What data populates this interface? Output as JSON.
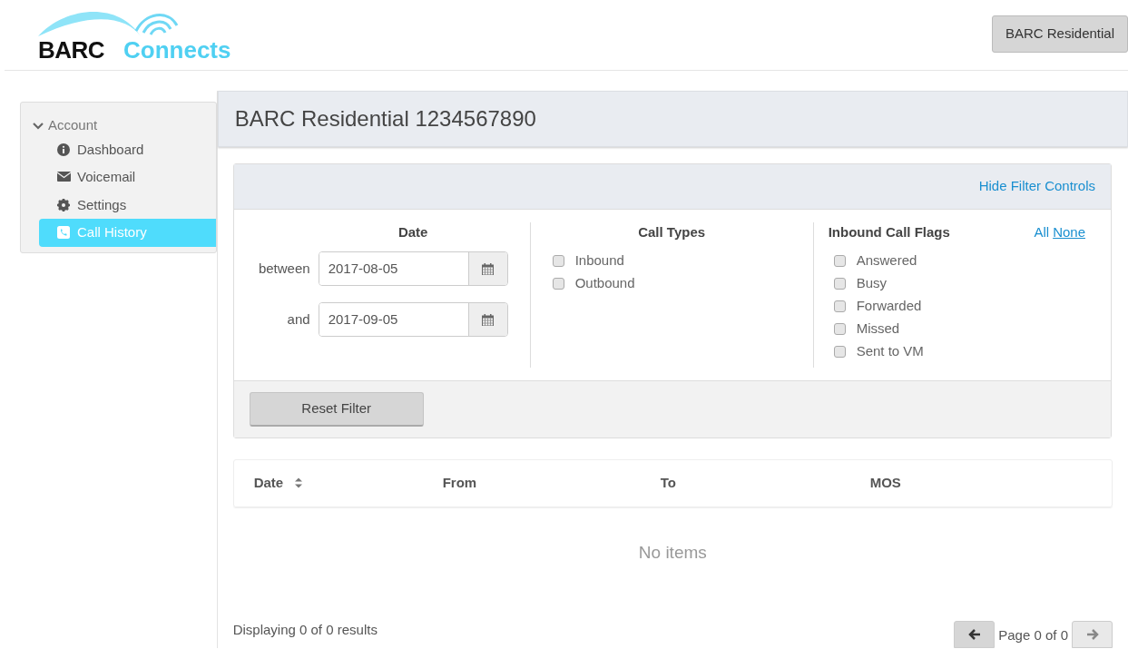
{
  "header": {
    "logo": {
      "word_1": "BARC",
      "word_2": "Connects"
    },
    "account_button": "BARC Residential"
  },
  "sidebar": {
    "group": {
      "label": "Account",
      "expanded": true,
      "items": [
        {
          "label": "Dashboard",
          "selected": false
        },
        {
          "label": "Voicemail",
          "selected": false
        },
        {
          "label": "Settings",
          "selected": false
        },
        {
          "label": "Call History",
          "selected": true
        }
      ]
    }
  },
  "page_title": "BARC Residential 1234567890",
  "filter": {
    "toggle_link": "Hide Filter Controls",
    "date": {
      "heading": "Date",
      "from_label": "between",
      "from_value": "2017-08-05",
      "to_label": "and",
      "to_value": "2017-09-05"
    },
    "call_types": {
      "heading": "Call Types",
      "options": [
        {
          "label": "Inbound",
          "checked": false
        },
        {
          "label": "Outbound",
          "checked": false
        }
      ]
    },
    "flags": {
      "heading": "Inbound Call Flags",
      "all_link": "All",
      "none_link": "None",
      "options": [
        {
          "label": "Answered",
          "checked": false
        },
        {
          "label": "Busy",
          "checked": false
        },
        {
          "label": "Forwarded",
          "checked": false
        },
        {
          "label": "Missed",
          "checked": false
        },
        {
          "label": "Sent to VM",
          "checked": false
        }
      ]
    },
    "reset_button": "Reset Filter"
  },
  "table": {
    "columns": [
      "Date",
      "From",
      "To",
      "MOS"
    ],
    "empty_text": "No items"
  },
  "footer": {
    "summary": "Displaying 0 of 0 results",
    "page_label": "Page 0 of 0",
    "prev_disabled": false,
    "next_disabled": true
  }
}
